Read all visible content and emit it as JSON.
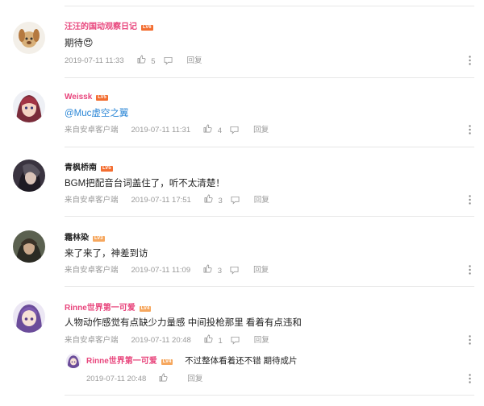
{
  "comments": [
    {
      "username": "汪汪的国动观察日记",
      "level": "LV6",
      "text": "期待",
      "emoji": "😍",
      "source": "",
      "time": "2019-07-11 11:33",
      "likes": "5",
      "reply_label": "回复",
      "name_color": "#e8457c",
      "level_color": "#f36d30"
    },
    {
      "username": "Weissk",
      "level": "LV5",
      "text": "@Muc虚空之翼",
      "source": "来自安卓客户端",
      "time": "2019-07-11 11:31",
      "likes": "4",
      "reply_label": "回复",
      "name_color": "#e8457c",
      "level_color": "#f36d30"
    },
    {
      "username": "青枫桥南",
      "level": "LV5",
      "text": "BGM把配音台词盖住了，听不太清楚！",
      "source": "来自安卓客户端",
      "time": "2019-07-11 17:51",
      "likes": "3",
      "reply_label": "回复",
      "name_color": "#222222",
      "level_color": "#f36d30"
    },
    {
      "username": "霜林染",
      "level": "LV3",
      "text": "来了来了，神差到访",
      "source": "来自安卓客户端",
      "time": "2019-07-11 11:09",
      "likes": "3",
      "reply_label": "回复",
      "name_color": "#222222",
      "level_color": "#f6a75e"
    },
    {
      "username": "Rinne世界第一可爱",
      "level": "LV4",
      "text": "人物动作感觉有点缺少力量感 中间投枪那里 看着有点违和",
      "source": "来自安卓客户端",
      "time": "2019-07-11 20:48",
      "likes": "1",
      "reply_label": "回复",
      "name_color": "#e8457c",
      "level_color": "#f6a75e"
    }
  ],
  "sub_reply": {
    "username": "Rinne世界第一可爱",
    "level": "LV4",
    "text": "不过整体看着还不错 期待成片",
    "time": "2019-07-11 20:48",
    "reply_label": "回复",
    "name_color": "#e8457c",
    "level_color": "#f6a75e"
  },
  "icons": {
    "like": "thumbs-up-icon",
    "reply": "speech-bubble-icon",
    "more": "vertical-dots-icon"
  }
}
